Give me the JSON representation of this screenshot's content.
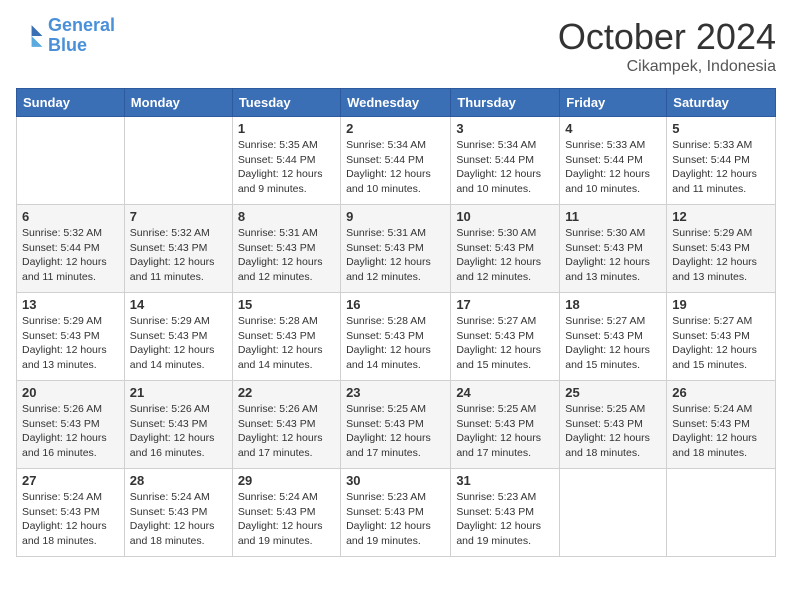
{
  "logo": {
    "text_general": "General",
    "text_blue": "Blue"
  },
  "header": {
    "month": "October 2024",
    "location": "Cikampek, Indonesia"
  },
  "weekdays": [
    "Sunday",
    "Monday",
    "Tuesday",
    "Wednesday",
    "Thursday",
    "Friday",
    "Saturday"
  ],
  "weeks": [
    [
      {
        "day": null,
        "info": null
      },
      {
        "day": null,
        "info": null
      },
      {
        "day": "1",
        "sunrise": "5:35 AM",
        "sunset": "5:44 PM",
        "daylight": "12 hours and 9 minutes."
      },
      {
        "day": "2",
        "sunrise": "5:34 AM",
        "sunset": "5:44 PM",
        "daylight": "12 hours and 10 minutes."
      },
      {
        "day": "3",
        "sunrise": "5:34 AM",
        "sunset": "5:44 PM",
        "daylight": "12 hours and 10 minutes."
      },
      {
        "day": "4",
        "sunrise": "5:33 AM",
        "sunset": "5:44 PM",
        "daylight": "12 hours and 10 minutes."
      },
      {
        "day": "5",
        "sunrise": "5:33 AM",
        "sunset": "5:44 PM",
        "daylight": "12 hours and 11 minutes."
      }
    ],
    [
      {
        "day": "6",
        "sunrise": "5:32 AM",
        "sunset": "5:44 PM",
        "daylight": "12 hours and 11 minutes."
      },
      {
        "day": "7",
        "sunrise": "5:32 AM",
        "sunset": "5:43 PM",
        "daylight": "12 hours and 11 minutes."
      },
      {
        "day": "8",
        "sunrise": "5:31 AM",
        "sunset": "5:43 PM",
        "daylight": "12 hours and 12 minutes."
      },
      {
        "day": "9",
        "sunrise": "5:31 AM",
        "sunset": "5:43 PM",
        "daylight": "12 hours and 12 minutes."
      },
      {
        "day": "10",
        "sunrise": "5:30 AM",
        "sunset": "5:43 PM",
        "daylight": "12 hours and 12 minutes."
      },
      {
        "day": "11",
        "sunrise": "5:30 AM",
        "sunset": "5:43 PM",
        "daylight": "12 hours and 13 minutes."
      },
      {
        "day": "12",
        "sunrise": "5:29 AM",
        "sunset": "5:43 PM",
        "daylight": "12 hours and 13 minutes."
      }
    ],
    [
      {
        "day": "13",
        "sunrise": "5:29 AM",
        "sunset": "5:43 PM",
        "daylight": "12 hours and 13 minutes."
      },
      {
        "day": "14",
        "sunrise": "5:29 AM",
        "sunset": "5:43 PM",
        "daylight": "12 hours and 14 minutes."
      },
      {
        "day": "15",
        "sunrise": "5:28 AM",
        "sunset": "5:43 PM",
        "daylight": "12 hours and 14 minutes."
      },
      {
        "day": "16",
        "sunrise": "5:28 AM",
        "sunset": "5:43 PM",
        "daylight": "12 hours and 14 minutes."
      },
      {
        "day": "17",
        "sunrise": "5:27 AM",
        "sunset": "5:43 PM",
        "daylight": "12 hours and 15 minutes."
      },
      {
        "day": "18",
        "sunrise": "5:27 AM",
        "sunset": "5:43 PM",
        "daylight": "12 hours and 15 minutes."
      },
      {
        "day": "19",
        "sunrise": "5:27 AM",
        "sunset": "5:43 PM",
        "daylight": "12 hours and 15 minutes."
      }
    ],
    [
      {
        "day": "20",
        "sunrise": "5:26 AM",
        "sunset": "5:43 PM",
        "daylight": "12 hours and 16 minutes."
      },
      {
        "day": "21",
        "sunrise": "5:26 AM",
        "sunset": "5:43 PM",
        "daylight": "12 hours and 16 minutes."
      },
      {
        "day": "22",
        "sunrise": "5:26 AM",
        "sunset": "5:43 PM",
        "daylight": "12 hours and 17 minutes."
      },
      {
        "day": "23",
        "sunrise": "5:25 AM",
        "sunset": "5:43 PM",
        "daylight": "12 hours and 17 minutes."
      },
      {
        "day": "24",
        "sunrise": "5:25 AM",
        "sunset": "5:43 PM",
        "daylight": "12 hours and 17 minutes."
      },
      {
        "day": "25",
        "sunrise": "5:25 AM",
        "sunset": "5:43 PM",
        "daylight": "12 hours and 18 minutes."
      },
      {
        "day": "26",
        "sunrise": "5:24 AM",
        "sunset": "5:43 PM",
        "daylight": "12 hours and 18 minutes."
      }
    ],
    [
      {
        "day": "27",
        "sunrise": "5:24 AM",
        "sunset": "5:43 PM",
        "daylight": "12 hours and 18 minutes."
      },
      {
        "day": "28",
        "sunrise": "5:24 AM",
        "sunset": "5:43 PM",
        "daylight": "12 hours and 18 minutes."
      },
      {
        "day": "29",
        "sunrise": "5:24 AM",
        "sunset": "5:43 PM",
        "daylight": "12 hours and 19 minutes."
      },
      {
        "day": "30",
        "sunrise": "5:23 AM",
        "sunset": "5:43 PM",
        "daylight": "12 hours and 19 minutes."
      },
      {
        "day": "31",
        "sunrise": "5:23 AM",
        "sunset": "5:43 PM",
        "daylight": "12 hours and 19 minutes."
      },
      {
        "day": null,
        "info": null
      },
      {
        "day": null,
        "info": null
      }
    ]
  ]
}
